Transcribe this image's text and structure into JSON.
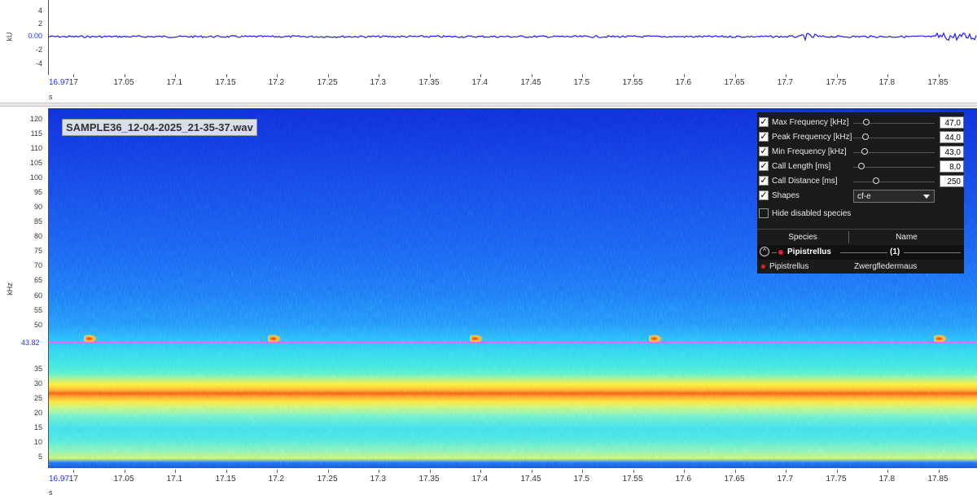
{
  "waveform": {
    "y_unit": "kU",
    "y_ticks": [
      "4",
      "2",
      "0.00",
      "-2",
      "-4"
    ],
    "cursor_value": "0.00",
    "x_unit": "s",
    "x_start": "16.97",
    "x_ticks": [
      "17",
      "17.05",
      "17.1",
      "17.15",
      "17.2",
      "17.25",
      "17.3",
      "17.35",
      "17.4",
      "17.45",
      "17.5",
      "17.55",
      "17.6",
      "17.65",
      "17.7",
      "17.75",
      "17.8",
      "17.85"
    ],
    "trace_color": "#1a1aff"
  },
  "spectrogram": {
    "file_name": "SAMPLE36_12-04-2025_21-35-37.wav",
    "y_unit": "kHz",
    "y_ticks": [
      "120",
      "115",
      "110",
      "105",
      "100",
      "95",
      "90",
      "85",
      "80",
      "75",
      "70",
      "65",
      "60",
      "55",
      "50",
      "35",
      "30",
      "25",
      "20",
      "15",
      "10",
      "5"
    ],
    "cursor_value": "43.82",
    "cursor_color": "#ff55ff",
    "x_unit": "s",
    "x_start": "16.97",
    "x_ticks": [
      "17",
      "17.05",
      "17.1",
      "17.15",
      "17.2",
      "17.25",
      "17.3",
      "17.35",
      "17.4",
      "17.45",
      "17.5",
      "17.55",
      "17.6",
      "17.65",
      "17.7",
      "17.75",
      "17.8",
      "17.85"
    ]
  },
  "filter_panel": {
    "params": [
      {
        "label": "Max Frequency [kHz]",
        "value": "47,0",
        "checked": true,
        "level": 0.06
      },
      {
        "label": "Peak Frequency [kHz]",
        "value": "44,0",
        "checked": true,
        "level": 0.05
      },
      {
        "label": "Min Frequency [kHz]",
        "value": "43,0",
        "checked": true,
        "level": 0.04
      },
      {
        "label": "Call Length [ms]",
        "value": "8,0",
        "checked": true,
        "level": 0.0
      },
      {
        "label": "Call Distance [ms]",
        "value": "250",
        "checked": true,
        "level": 0.18
      }
    ],
    "shapes_label": "Shapes",
    "shapes_value": "cf-e",
    "hide_disabled_label": "Hide disabled species",
    "table_headers": {
      "species": "Species",
      "name": "Name"
    },
    "group": {
      "label": "Pipistrellus",
      "count": "(1)"
    },
    "rows": [
      {
        "species": "Pipistrellus",
        "name": "Zwergfledermaus"
      }
    ],
    "marker_color": "#e02020"
  }
}
